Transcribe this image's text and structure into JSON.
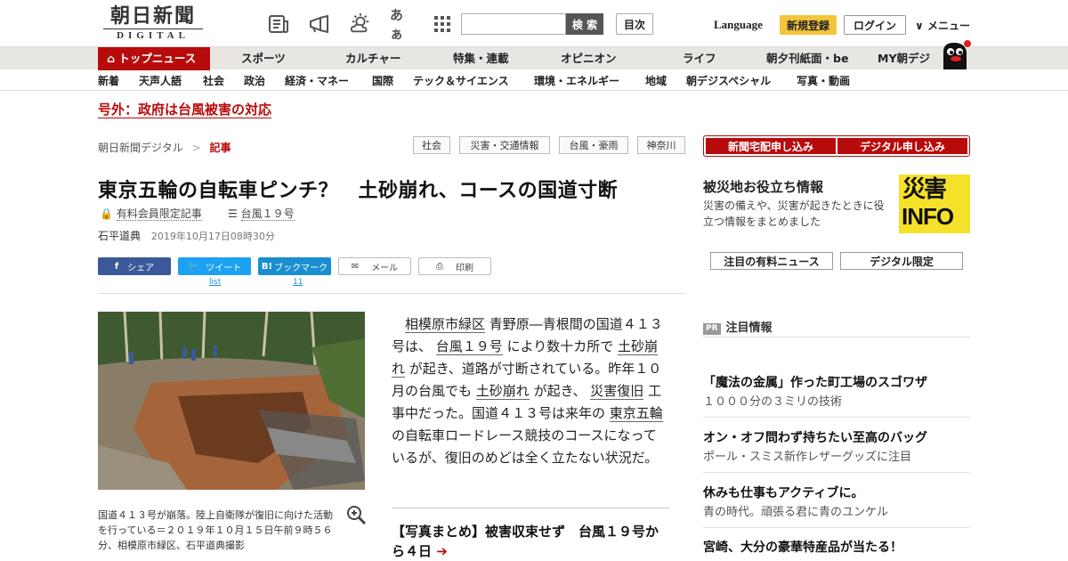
{
  "header": {
    "logo_kanji": "朝日新聞",
    "logo_sub": "DIGITAL",
    "search_placeholder": "",
    "search_label": "検 索",
    "toc_label": "目次",
    "language_label": "Language",
    "register_label": "新規登録",
    "login_label": "ログイン",
    "menu_label": "メニュー",
    "icons": [
      "newspaper-icon",
      "megaphone-icon",
      "weather-icon",
      "font-size-icon",
      "grid-icon"
    ],
    "font_icon_text": "あぁ"
  },
  "main_nav": {
    "top_news": "トップニュース",
    "items": [
      "スポーツ",
      "カルチャー",
      "特集・連載",
      "オピニオン",
      "ライフ",
      "朝夕刊紙面・be",
      "MY朝デジ"
    ]
  },
  "sub_nav": {
    "items": [
      "新着",
      "天声人語",
      "社会",
      "政治",
      "経済・マネー",
      "国際",
      "テック＆サイエンス",
      "環境・エネルギー",
      "地域",
      "朝デジスペシャル",
      "写真・動画"
    ]
  },
  "breaking": "号外：政府は台風被害の対応",
  "breadcrumb": {
    "home": "朝日新聞デジタル",
    "sep": ">",
    "current": "記事"
  },
  "tags": [
    "社会",
    "災害・交通情報",
    "台風・豪雨",
    "神奈川"
  ],
  "article": {
    "title": "東京五輪の自転車ピンチ？　土砂崩れ、コースの国道寸断",
    "premium_label": "有料会員限定記事",
    "series_label": "台風１９号",
    "author": "石平道典",
    "date": "2019年10月17日08時30分",
    "share": {
      "facebook": "シェア",
      "twitter": "ツイート",
      "twitter_count": "list",
      "hatena": "ブックマーク",
      "hatena_count": "11",
      "mail": "メール",
      "print": "印刷"
    },
    "photo_caption": "国道４１３号が崩落。陸上自衛隊が復旧に向けた活動を行っている＝２０１９年１０月１５日午前９時５６分、相模原市緑区、石平道典撮影",
    "body_parts": {
      "p1": "相模原市緑区",
      "p2": " 青野原―青根間の国道４１３号は、 ",
      "p3": "台風１９号",
      "p4": " により数十カ所で ",
      "p5": "土砂崩れ",
      "p6": " が起き、道路が寸断されている。昨年１０月の台風でも ",
      "p7": "土砂崩れ",
      "p8": " が起き、 ",
      "p9": "災害復旧",
      "p10": " 工事中だった。国道４１３号は来年の ",
      "p11": "東京五輪",
      "p12": " の自転車ロードレース競技のコースになっているが、復旧のめどは全く立たない状況だ。"
    },
    "related": "【写真まとめ】被害収束せず　台風１９号から４日",
    "related_arrow": "➔"
  },
  "sidebar": {
    "subscribe_paper": "新聞宅配申し込み",
    "subscribe_digital": "デジタル申し込み",
    "disaster_title": "被災地お役立ち情報",
    "disaster_desc": "災害の備えや、災害が起きたときに役立つ情報をまとめました",
    "info_a": "災害",
    "info_b": "INFO",
    "btn_premium_news": "注目の有料ニュース",
    "btn_digital_only": "デジタル限定",
    "pr_mark": "PR",
    "pr_heading": "注目情報",
    "ads": [
      {
        "headline": "「魔法の金属」作った町工場のスゴワザ",
        "sub": "１０００分の３ミリの技術"
      },
      {
        "headline": "オン・オフ問わず持ちたい至高のバッグ",
        "sub": "ポール・スミス新作レザーグッズに注目"
      },
      {
        "headline": "休みも仕事もアクティブに。",
        "sub": "青の時代。頑張る君に青のユンケル"
      },
      {
        "headline": "宮崎、大分の豪華特産品が当たる！",
        "sub": ""
      }
    ]
  },
  "colors": {
    "brand_red": "#b80b0b",
    "register_yellow": "#f4c53b",
    "facebook": "#3b5998",
    "twitter": "#1da1f2",
    "hatena": "#1a8ed1"
  }
}
